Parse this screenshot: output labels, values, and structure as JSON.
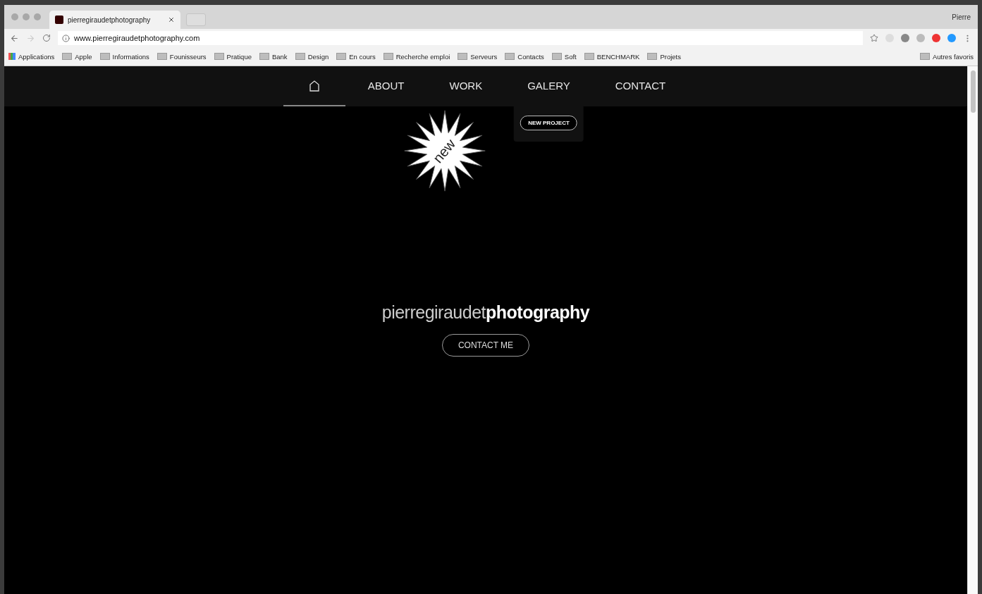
{
  "browser": {
    "tab_title": "pierregiraudetphotography",
    "profile": "Pierre",
    "url": "www.pierregiraudetphotography.com",
    "bookmarks": [
      {
        "label": "Applications",
        "kind": "apps"
      },
      {
        "label": "Apple",
        "kind": "folder"
      },
      {
        "label": "Informations",
        "kind": "folder"
      },
      {
        "label": "Founisseurs",
        "kind": "folder"
      },
      {
        "label": "Pratique",
        "kind": "folder"
      },
      {
        "label": "Bank",
        "kind": "folder"
      },
      {
        "label": "Design",
        "kind": "folder"
      },
      {
        "label": "En cours",
        "kind": "folder"
      },
      {
        "label": "Recherche emploi",
        "kind": "folder"
      },
      {
        "label": "Serveurs",
        "kind": "folder"
      },
      {
        "label": "Contacts",
        "kind": "folder"
      },
      {
        "label": "Soft",
        "kind": "folder"
      },
      {
        "label": "BENCHMARK",
        "kind": "folder"
      },
      {
        "label": "Projets",
        "kind": "folder"
      }
    ],
    "other_bookmarks": "Autres favoris"
  },
  "nav": {
    "items": [
      {
        "kind": "home",
        "selected": true
      },
      {
        "kind": "text",
        "label": "ABOUT",
        "selected": false
      },
      {
        "kind": "text",
        "label": "WORK",
        "selected": false,
        "badge": "new"
      },
      {
        "kind": "text",
        "label": "GALERY",
        "selected": false,
        "submenu": [
          "NEW PROJECT"
        ]
      },
      {
        "kind": "text",
        "label": "CONTACT",
        "selected": false
      }
    ]
  },
  "hero": {
    "logo": "pierregiraudet**photography**",
    "button": "CONTACT ME"
  }
}
